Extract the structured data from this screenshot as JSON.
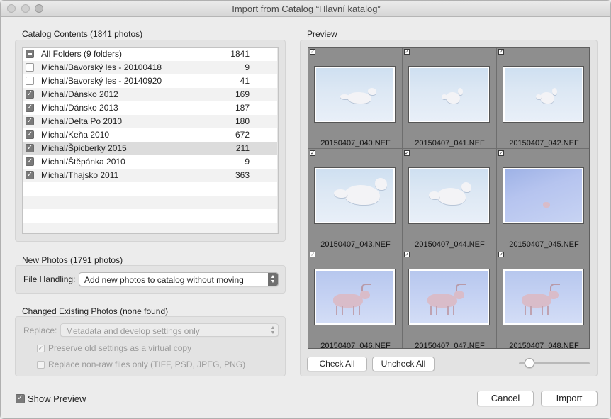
{
  "window": {
    "title": "Import from Catalog “Hlavní katalog”"
  },
  "catalog": {
    "label": "Catalog Contents (1841 photos)",
    "folders": [
      {
        "name": "All Folders (9 folders)",
        "count": "1841",
        "state": "mixed"
      },
      {
        "name": "Michal/Bavorský les - 20100418",
        "count": "9",
        "state": "off"
      },
      {
        "name": "Michal/Bavorský les - 20140920",
        "count": "41",
        "state": "off"
      },
      {
        "name": "Michal/Dánsko 2012",
        "count": "169",
        "state": "on"
      },
      {
        "name": "Michal/Dánsko 2013",
        "count": "187",
        "state": "on"
      },
      {
        "name": "Michal/Delta Po 2010",
        "count": "180",
        "state": "on"
      },
      {
        "name": "Michal/Keňa 2010",
        "count": "672",
        "state": "on"
      },
      {
        "name": "Michal/Špicberky 2015",
        "count": "211",
        "state": "on"
      },
      {
        "name": "Michal/Štěpánka 2010",
        "count": "9",
        "state": "on"
      },
      {
        "name": "Michal/Thajsko 2011",
        "count": "363",
        "state": "on"
      }
    ]
  },
  "new_photos": {
    "label": "New Photos (1791 photos)",
    "file_handling_label": "File Handling:",
    "file_handling_value": "Add new photos to catalog without moving"
  },
  "changed": {
    "label": "Changed Existing Photos (none found)",
    "replace_label": "Replace:",
    "replace_value": "Metadata and develop settings only",
    "preserve_label": "Preserve old settings as a virtual copy",
    "nonraw_label": "Replace non-raw files only (TIFF, PSD, JPEG, PNG)"
  },
  "preview": {
    "label": "Preview",
    "photos": [
      {
        "file": "20150407_040.NEF",
        "kind": "fox-walk"
      },
      {
        "file": "20150407_041.NEF",
        "kind": "fox-small"
      },
      {
        "file": "20150407_042.NEF",
        "kind": "fox-small"
      },
      {
        "file": "20150407_043.NEF",
        "kind": "fox-big"
      },
      {
        "file": "20150407_044.NEF",
        "kind": "fox-mid"
      },
      {
        "file": "20150407_045.NEF",
        "kind": "tiny"
      },
      {
        "file": "20150407_046.NEF",
        "kind": "reindeer"
      },
      {
        "file": "20150407_047.NEF",
        "kind": "reindeer"
      },
      {
        "file": "20150407_048.NEF",
        "kind": "reindeer"
      }
    ],
    "check_all": "Check All",
    "uncheck_all": "Uncheck All",
    "zoom": 0.15
  },
  "footer": {
    "show_preview": "Show Preview",
    "cancel": "Cancel",
    "import": "Import"
  }
}
